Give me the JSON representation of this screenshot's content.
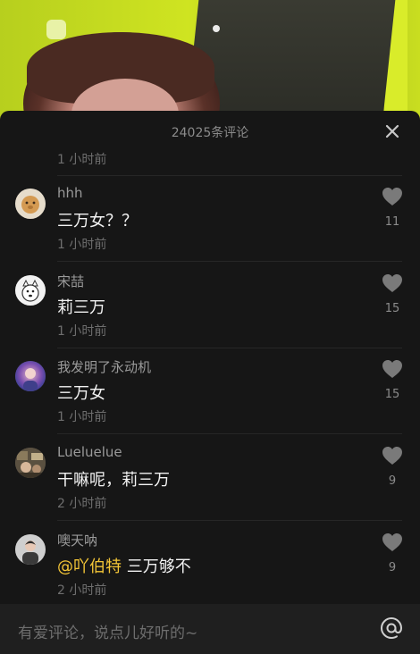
{
  "sheet": {
    "comment_count": "24025条评论",
    "prev_comment_time": "1 小时前"
  },
  "comments": [
    {
      "username": "hhh",
      "text": "三万女？？",
      "time": "1 小时前",
      "likes": "11"
    },
    {
      "username": "宋喆",
      "text": "莉三万",
      "time": "1 小时前",
      "likes": "15"
    },
    {
      "username": "我发明了永动机",
      "text": "三万女",
      "time": "1 小时前",
      "likes": "15"
    },
    {
      "username": "Lueluelue",
      "text": "干嘛呢，莉三万",
      "time": "2 小时前",
      "likes": "9"
    },
    {
      "username": "噢天呐",
      "mention": "@吖伯特",
      "text": " 三万够不",
      "time": "2 小时前",
      "likes": "9"
    }
  ],
  "input": {
    "placeholder": "有爱评论，说点儿好听的~"
  },
  "icons": {
    "close": "close-icon",
    "like": "heart-icon",
    "at": "at-icon"
  },
  "colors": {
    "sheet_bg": "#161616",
    "mention": "#f3c537",
    "like_gray": "#8b8b8b"
  }
}
